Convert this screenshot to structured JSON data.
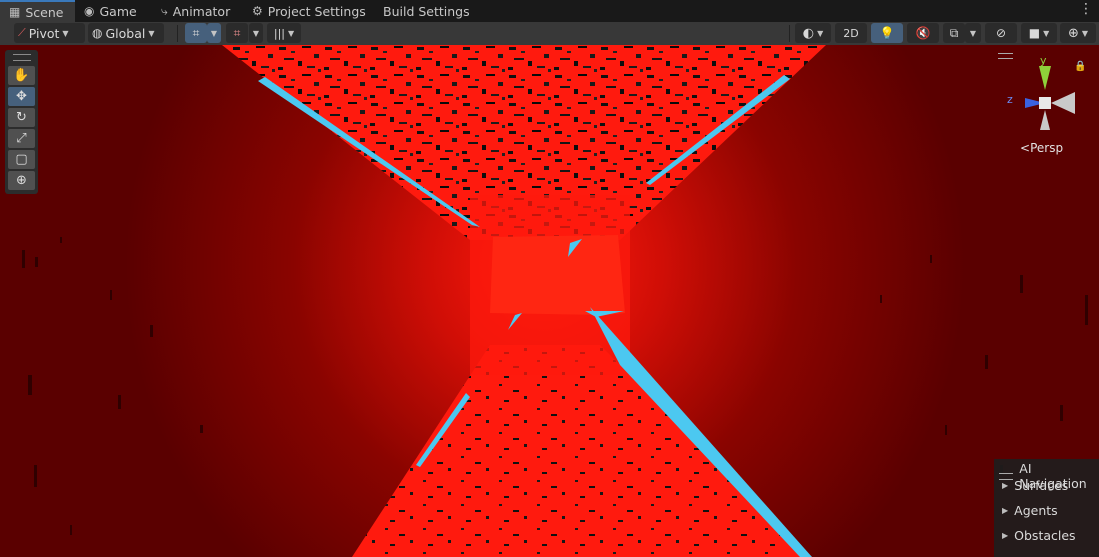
{
  "tabs": [
    {
      "label": "Scene",
      "icon": "grid-icon",
      "active": true
    },
    {
      "label": "Game",
      "icon": "gamepad-icon",
      "active": false
    },
    {
      "label": "Animator",
      "icon": "animator-icon",
      "active": false
    },
    {
      "label": "Project Settings",
      "icon": "gear-icon",
      "active": false
    },
    {
      "label": "Build Settings",
      "icon": "",
      "active": false
    }
  ],
  "more_menu": "⋮",
  "toolbar": {
    "pivot_label": "Pivot",
    "global_label": "Global",
    "mode_2d_label": "2D"
  },
  "tools": [
    {
      "name": "hand-tool",
      "icon": "hand-icon",
      "active": false
    },
    {
      "name": "move-tool",
      "icon": "move-icon",
      "active": true
    },
    {
      "name": "rotate-tool",
      "icon": "rotate-icon",
      "active": false
    },
    {
      "name": "scale-tool",
      "icon": "scale-icon",
      "active": false
    },
    {
      "name": "rect-tool",
      "icon": "rect-icon",
      "active": false
    },
    {
      "name": "transform-tool",
      "icon": "transform-icon",
      "active": false
    }
  ],
  "gizmo": {
    "y_axis": "y",
    "z_axis": "z",
    "projection_label": "Persp"
  },
  "ai_navigation": {
    "title": "AI Navigation",
    "items": [
      "Surfaces",
      "Agents",
      "Obstacles"
    ]
  },
  "colors": {
    "accent": "#3a79bb",
    "viewport_red": "#ff1a0e",
    "cyan_edge": "#4cc8f0"
  }
}
